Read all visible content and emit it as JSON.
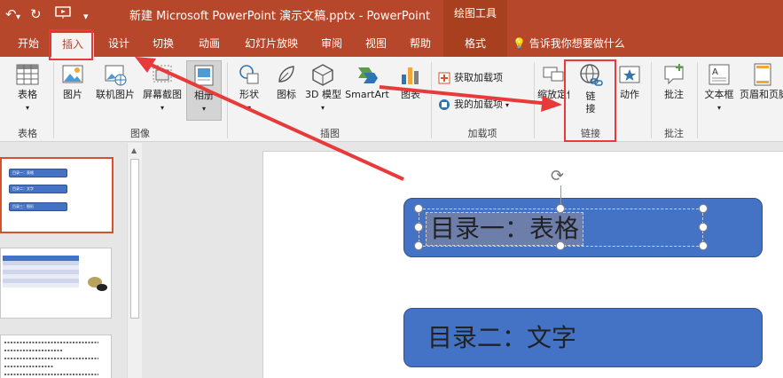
{
  "titlebar": {
    "doc_title": "新建 Microsoft PowerPoint 演示文稿.pptx  -  PowerPoint",
    "contextual_title": "绘图工具"
  },
  "tabs": [
    {
      "label": "开始"
    },
    {
      "label": "插入"
    },
    {
      "label": "设计"
    },
    {
      "label": "切换"
    },
    {
      "label": "动画"
    },
    {
      "label": "幻灯片放映"
    },
    {
      "label": "审阅"
    },
    {
      "label": "视图"
    },
    {
      "label": "帮助"
    },
    {
      "label": "格式"
    }
  ],
  "tell_me": "告诉我你想要做什么",
  "ribbon": {
    "table": {
      "label": "表格",
      "group": "表格"
    },
    "images": {
      "picture": "图片",
      "online_picture": "联机图片",
      "screenshot": "屏幕截图",
      "album": "相册",
      "group": "图像"
    },
    "illustrations": {
      "shapes": "形状",
      "icons": "图标",
      "model_3d": "3D 模型",
      "smartart": "SmartArt",
      "chart": "图表",
      "group": "插图"
    },
    "addins": {
      "get": "获取加载项",
      "mine": "我的加载项",
      "group": "加载项"
    },
    "links": {
      "zoom": "缩放定位",
      "link": "链接",
      "action": "动作",
      "group": "链接"
    },
    "comments": {
      "comment": "批注",
      "group": "批注"
    },
    "text": {
      "textbox": "文本框",
      "header_footer": "页眉和页脚"
    }
  },
  "thumbnails": {
    "slide1": [
      "目录一：表格",
      "目录二：文字",
      "目录三：图形"
    ]
  },
  "slide": {
    "box1_text": "目录一：表格",
    "box2_text": "目录二：文字"
  },
  "colors": {
    "accent": "#b7472a",
    "shape_fill": "#4472c4",
    "annotation": "#e83a3a"
  }
}
